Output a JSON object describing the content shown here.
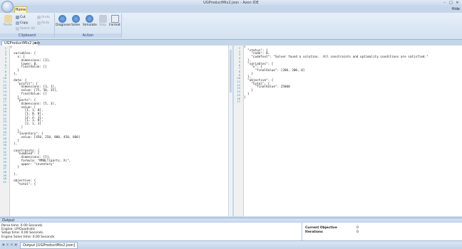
{
  "window": {
    "title": "UGProductMix2.json - Axon IDE",
    "min": "–",
    "max": "□",
    "close": "✕"
  },
  "ribbon": {
    "tab_home": "Home",
    "hide": "Hide",
    "clipboard": {
      "paste": "Paste",
      "cut": "Cut",
      "copy": "Copy",
      "select_all": "Select All",
      "label": "Clipboard"
    },
    "undo": "Undo",
    "redo": "Redo",
    "action": {
      "diagnose": "Diagnose",
      "solve": "Solve",
      "simulate": "Simulate",
      "stop": "Stop",
      "format": "Format",
      "label": "Action"
    }
  },
  "document_tab": {
    "label": "UGProductMix2.json",
    "close": "x"
  },
  "editor_left": {
    "line_numbers": [
      "1",
      "2",
      "3",
      "4",
      "5",
      "6",
      "7",
      "8",
      "9",
      "10",
      "11",
      "12",
      "13",
      "14",
      "15",
      "16",
      "17",
      "18",
      "19",
      "20",
      "21",
      "22",
      "23",
      "24",
      "25",
      "26",
      "27",
      "28",
      "29",
      "30",
      "31",
      "32",
      "33",
      "34",
      "35",
      "36",
      "37",
      "38",
      "39",
      "40",
      "41"
    ],
    "lines": [
      "{",
      "",
      "  variables: {",
      "    x: {",
      "      dimensions: [3],",
      "      lower: 0,",
      "      finalValue: []",
      "    }",
      "  },",
      "",
      "  data: {",
      "    \"profit\": {",
      "      dimensions: [3, 1],",
      "      value: [75, 50, 35],",
      "      finalValue: []",
      "    },",
      "    \"parts\": {",
      "      dimensions: [5, 3],",
      "      value: [",
      "        [1, 1, 0],",
      "        [1, 0, 0],",
      "        [2, 2, 1],",
      "        [1, 1, 0],",
      "        [2, 1, 1]",
      "      ]",
      "    },",
      "    \"inventory\": {",
      "      value: [450, 250, 800, 450, 600]",
      "    }",
      "  },",
      "",
      "  constraints: {",
      "    \"numUsed\": {",
      "      dimensions: [5],",
      "      formula: \"MMULT(parts, X)\",",
      "      upper: \"inventory\"",
      "    }",
      "",
      "  },",
      "",
      "  objective: {",
      "    \"total\": {"
    ]
  },
  "editor_right": {
    "line_numbers": [
      "1",
      "2",
      "3",
      "4",
      "5",
      "6",
      "7",
      "8",
      "9",
      "10",
      "11",
      "12",
      "13",
      "14",
      "15",
      "16",
      "17"
    ],
    "lines": [
      "{",
      "  \"status\": {",
      "    \"code\": 0,",
      "    \"codeText\": \"Solver found a solution.  All constraints and optimality conditions are satisfied.\"",
      "  },",
      "  \"variables\": {",
      "    \"x\": {",
      "      \"finalValue\": [200, 200, 0]",
      "    }",
      "  },",
      "  \"objective\": {",
      "    \"total\": {",
      "      \"finalValue\": 25000",
      "    }",
      "  }",
      "}",
      ""
    ]
  },
  "output": {
    "header": "Output",
    "lines": [
      "Parse time: 0.00 Seconds.",
      "Engine: LP/Quadratic",
      "Setup time: 0.00 Seconds.",
      "Engine Solve time: 0.00 Seconds."
    ],
    "results": [
      {
        "label": "Current Objective",
        "value": "0"
      },
      {
        "label": "Iterations",
        "value": "0"
      }
    ],
    "tab": "Output [UGProductMix2.json]"
  }
}
